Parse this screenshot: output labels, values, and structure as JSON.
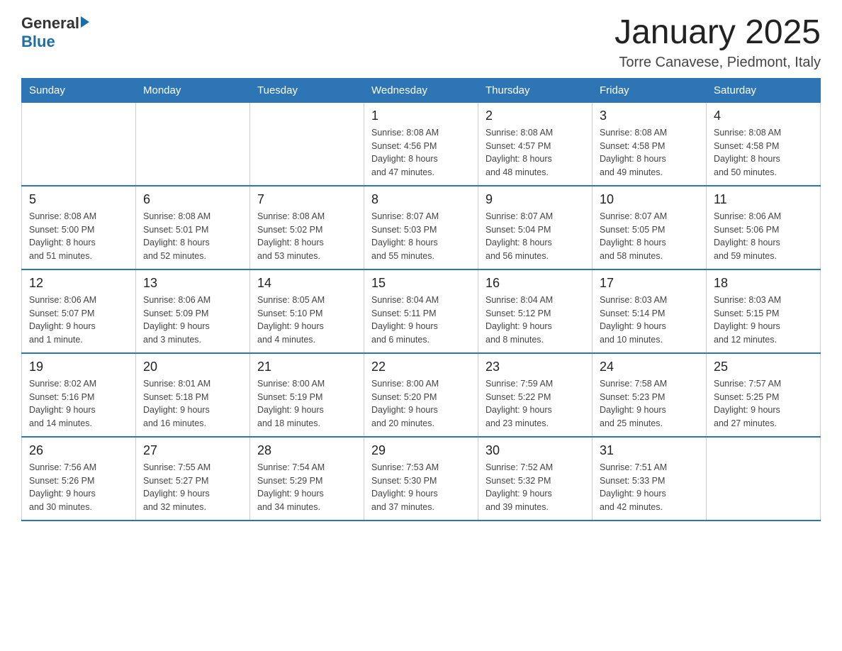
{
  "header": {
    "logo_general": "General",
    "logo_blue": "Blue",
    "title": "January 2025",
    "subtitle": "Torre Canavese, Piedmont, Italy"
  },
  "weekdays": [
    "Sunday",
    "Monday",
    "Tuesday",
    "Wednesday",
    "Thursday",
    "Friday",
    "Saturday"
  ],
  "weeks": [
    [
      {
        "day": "",
        "info": ""
      },
      {
        "day": "",
        "info": ""
      },
      {
        "day": "",
        "info": ""
      },
      {
        "day": "1",
        "info": "Sunrise: 8:08 AM\nSunset: 4:56 PM\nDaylight: 8 hours\nand 47 minutes."
      },
      {
        "day": "2",
        "info": "Sunrise: 8:08 AM\nSunset: 4:57 PM\nDaylight: 8 hours\nand 48 minutes."
      },
      {
        "day": "3",
        "info": "Sunrise: 8:08 AM\nSunset: 4:58 PM\nDaylight: 8 hours\nand 49 minutes."
      },
      {
        "day": "4",
        "info": "Sunrise: 8:08 AM\nSunset: 4:58 PM\nDaylight: 8 hours\nand 50 minutes."
      }
    ],
    [
      {
        "day": "5",
        "info": "Sunrise: 8:08 AM\nSunset: 5:00 PM\nDaylight: 8 hours\nand 51 minutes."
      },
      {
        "day": "6",
        "info": "Sunrise: 8:08 AM\nSunset: 5:01 PM\nDaylight: 8 hours\nand 52 minutes."
      },
      {
        "day": "7",
        "info": "Sunrise: 8:08 AM\nSunset: 5:02 PM\nDaylight: 8 hours\nand 53 minutes."
      },
      {
        "day": "8",
        "info": "Sunrise: 8:07 AM\nSunset: 5:03 PM\nDaylight: 8 hours\nand 55 minutes."
      },
      {
        "day": "9",
        "info": "Sunrise: 8:07 AM\nSunset: 5:04 PM\nDaylight: 8 hours\nand 56 minutes."
      },
      {
        "day": "10",
        "info": "Sunrise: 8:07 AM\nSunset: 5:05 PM\nDaylight: 8 hours\nand 58 minutes."
      },
      {
        "day": "11",
        "info": "Sunrise: 8:06 AM\nSunset: 5:06 PM\nDaylight: 8 hours\nand 59 minutes."
      }
    ],
    [
      {
        "day": "12",
        "info": "Sunrise: 8:06 AM\nSunset: 5:07 PM\nDaylight: 9 hours\nand 1 minute."
      },
      {
        "day": "13",
        "info": "Sunrise: 8:06 AM\nSunset: 5:09 PM\nDaylight: 9 hours\nand 3 minutes."
      },
      {
        "day": "14",
        "info": "Sunrise: 8:05 AM\nSunset: 5:10 PM\nDaylight: 9 hours\nand 4 minutes."
      },
      {
        "day": "15",
        "info": "Sunrise: 8:04 AM\nSunset: 5:11 PM\nDaylight: 9 hours\nand 6 minutes."
      },
      {
        "day": "16",
        "info": "Sunrise: 8:04 AM\nSunset: 5:12 PM\nDaylight: 9 hours\nand 8 minutes."
      },
      {
        "day": "17",
        "info": "Sunrise: 8:03 AM\nSunset: 5:14 PM\nDaylight: 9 hours\nand 10 minutes."
      },
      {
        "day": "18",
        "info": "Sunrise: 8:03 AM\nSunset: 5:15 PM\nDaylight: 9 hours\nand 12 minutes."
      }
    ],
    [
      {
        "day": "19",
        "info": "Sunrise: 8:02 AM\nSunset: 5:16 PM\nDaylight: 9 hours\nand 14 minutes."
      },
      {
        "day": "20",
        "info": "Sunrise: 8:01 AM\nSunset: 5:18 PM\nDaylight: 9 hours\nand 16 minutes."
      },
      {
        "day": "21",
        "info": "Sunrise: 8:00 AM\nSunset: 5:19 PM\nDaylight: 9 hours\nand 18 minutes."
      },
      {
        "day": "22",
        "info": "Sunrise: 8:00 AM\nSunset: 5:20 PM\nDaylight: 9 hours\nand 20 minutes."
      },
      {
        "day": "23",
        "info": "Sunrise: 7:59 AM\nSunset: 5:22 PM\nDaylight: 9 hours\nand 23 minutes."
      },
      {
        "day": "24",
        "info": "Sunrise: 7:58 AM\nSunset: 5:23 PM\nDaylight: 9 hours\nand 25 minutes."
      },
      {
        "day": "25",
        "info": "Sunrise: 7:57 AM\nSunset: 5:25 PM\nDaylight: 9 hours\nand 27 minutes."
      }
    ],
    [
      {
        "day": "26",
        "info": "Sunrise: 7:56 AM\nSunset: 5:26 PM\nDaylight: 9 hours\nand 30 minutes."
      },
      {
        "day": "27",
        "info": "Sunrise: 7:55 AM\nSunset: 5:27 PM\nDaylight: 9 hours\nand 32 minutes."
      },
      {
        "day": "28",
        "info": "Sunrise: 7:54 AM\nSunset: 5:29 PM\nDaylight: 9 hours\nand 34 minutes."
      },
      {
        "day": "29",
        "info": "Sunrise: 7:53 AM\nSunset: 5:30 PM\nDaylight: 9 hours\nand 37 minutes."
      },
      {
        "day": "30",
        "info": "Sunrise: 7:52 AM\nSunset: 5:32 PM\nDaylight: 9 hours\nand 39 minutes."
      },
      {
        "day": "31",
        "info": "Sunrise: 7:51 AM\nSunset: 5:33 PM\nDaylight: 9 hours\nand 42 minutes."
      },
      {
        "day": "",
        "info": ""
      }
    ]
  ]
}
